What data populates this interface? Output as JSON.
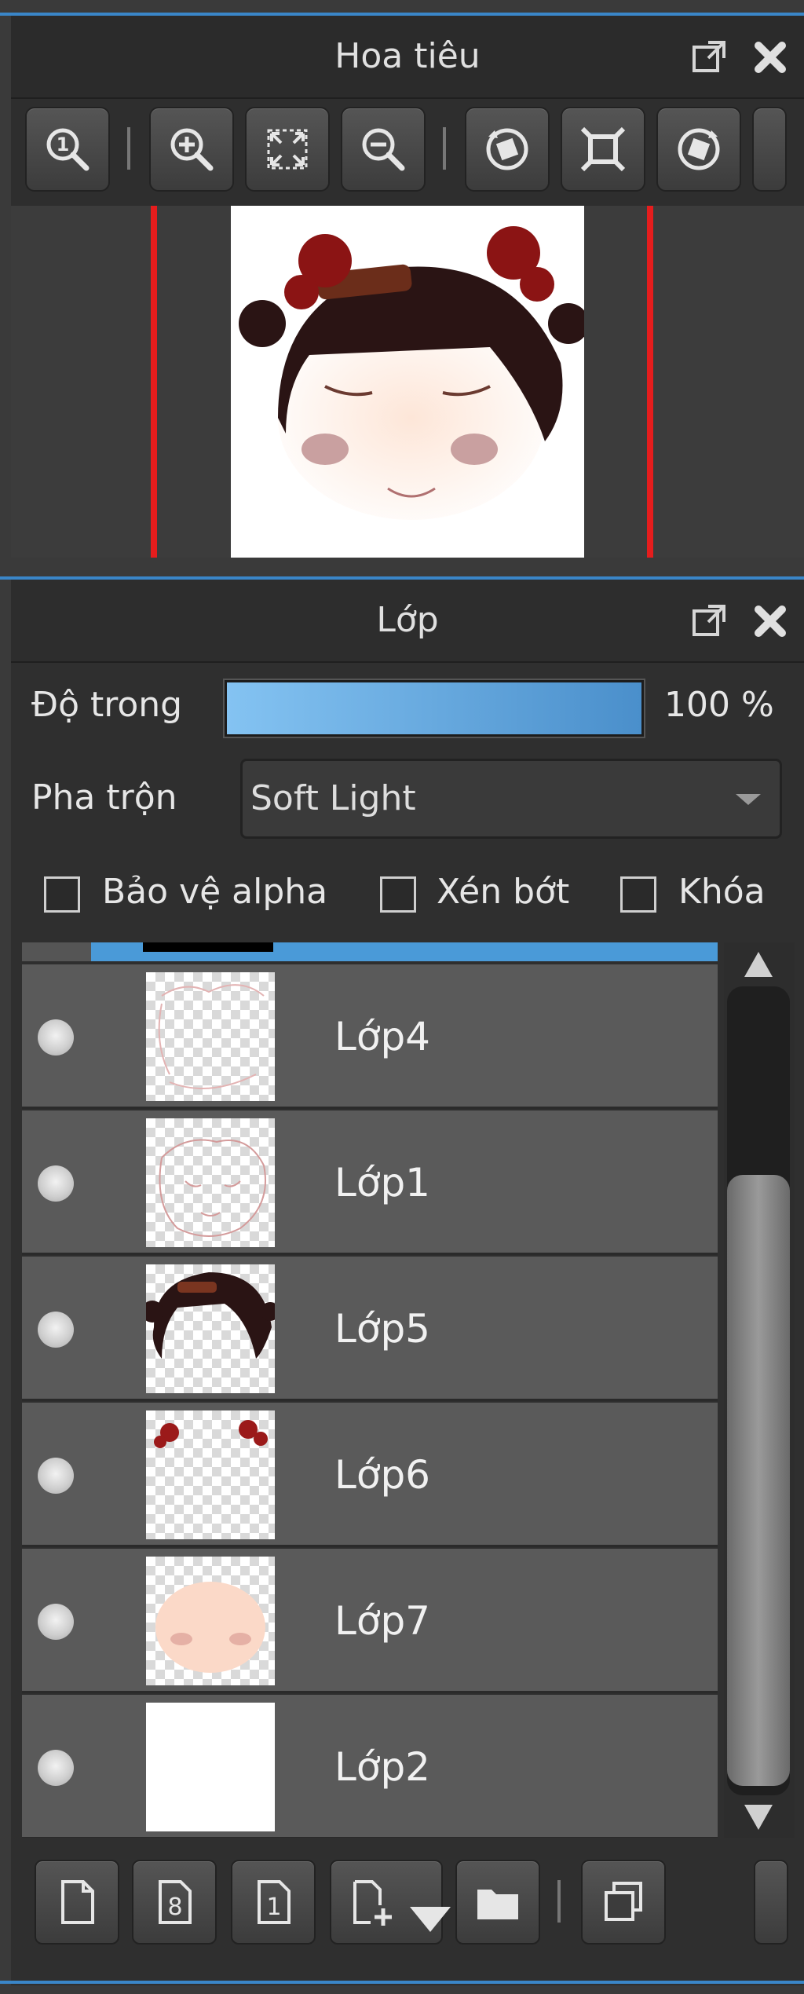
{
  "navigator": {
    "title": "Hoa tiêu",
    "toolbar": [
      "zoom-actual-size",
      "zoom-in",
      "fit-to-window",
      "zoom-out",
      "rotate-left",
      "reset-view",
      "rotate-right"
    ]
  },
  "layers_panel": {
    "title": "Lớp",
    "opacity_label": "Độ trong",
    "opacity_value": "100 %",
    "opacity_fraction": 1.0,
    "blend_label": "Pha trộn",
    "blend_mode": "Soft Light",
    "checkboxes": {
      "protect_alpha": "Bảo vệ alpha",
      "clipping": "Xén bớt",
      "lock": "Khóa"
    },
    "layers": [
      {
        "name": "Lớp4",
        "thumb": "sketch-outline"
      },
      {
        "name": "Lớp1",
        "thumb": "sketch-face"
      },
      {
        "name": "Lớp5",
        "thumb": "hair"
      },
      {
        "name": "Lớp6",
        "thumb": "hair-buns"
      },
      {
        "name": "Lớp7",
        "thumb": "skin"
      },
      {
        "name": "Lớp2",
        "thumb": "white-fill"
      }
    ],
    "bottom_toolbar": [
      "new-layer",
      "new-8bit-layer",
      "new-1bit-layer",
      "add-layer-menu",
      "new-folder",
      "duplicate-layer"
    ]
  },
  "colors": {
    "accent": "#3a86c8",
    "navigator_frame": "#e51d1d",
    "panel_bg": "#2d2d2d",
    "row_bg": "#5a5a5a"
  }
}
